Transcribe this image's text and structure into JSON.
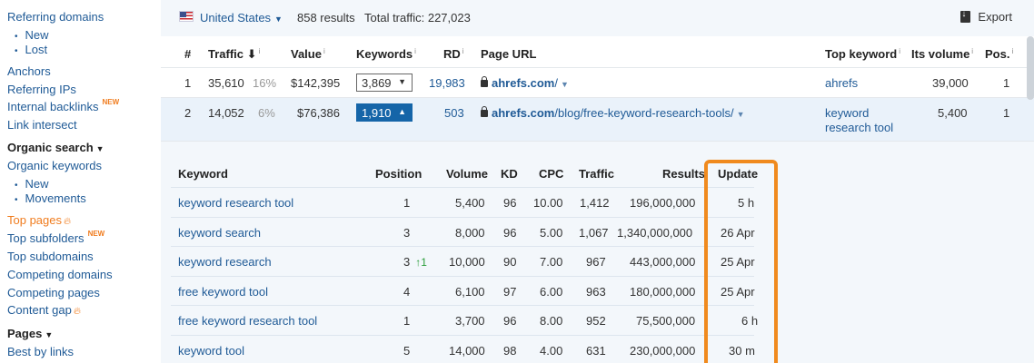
{
  "sidebar": {
    "referring_domains": "Referring domains",
    "rd_new": "New",
    "rd_lost": "Lost",
    "anchors": "Anchors",
    "referring_ips": "Referring IPs",
    "internal_backlinks": "Internal backlinks",
    "new_badge": "NEW",
    "link_intersect": "Link intersect",
    "organic_search": "Organic search",
    "organic_keywords": "Organic keywords",
    "ok_new": "New",
    "ok_movements": "Movements",
    "top_pages": "Top pages",
    "top_subfolders": "Top subfolders",
    "top_subdomains": "Top subdomains",
    "competing_domains": "Competing domains",
    "competing_pages": "Competing pages",
    "content_gap": "Content gap",
    "pages": "Pages",
    "best_by_links": "Best by links"
  },
  "topbar": {
    "country": "United States",
    "results": "858 results",
    "total_traffic": "Total traffic: 227,023",
    "export": "Export"
  },
  "pages_table": {
    "headers": {
      "num": "#",
      "traffic": "Traffic",
      "value": "Value",
      "keywords": "Keywords",
      "rd": "RD",
      "page_url": "Page URL",
      "top_keyword": "Top keyword",
      "its_volume": "Its volume",
      "pos": "Pos."
    },
    "rows": [
      {
        "num": "1",
        "traffic": "35,610",
        "share": "16%",
        "value": "$142,395",
        "keywords": "3,869",
        "rd": "19,983",
        "domain": "ahrefs.com",
        "path": "/",
        "top_keyword": "ahrefs",
        "top_keyword_2": "",
        "volume": "39,000",
        "pos": "1"
      },
      {
        "num": "2",
        "traffic": "14,052",
        "share": "6%",
        "value": "$76,386",
        "keywords": "1,910",
        "rd": "503",
        "domain": "ahrefs.com",
        "path": "/blog/free-keyword-research-tools/",
        "top_keyword": "keyword",
        "top_keyword_2": "research tool",
        "volume": "5,400",
        "pos": "1"
      }
    ]
  },
  "keyword_table": {
    "headers": {
      "keyword": "Keyword",
      "position": "Position",
      "volume": "Volume",
      "kd": "KD",
      "cpc": "CPC",
      "traffic": "Traffic",
      "results": "Results",
      "update": "Update"
    },
    "rows": [
      {
        "keyword": "keyword research tool",
        "position": "1",
        "change": "",
        "volume": "5,400",
        "kd": "96",
        "cpc": "10.00",
        "traffic": "1,412",
        "results": "196,000,000",
        "update": "5 h"
      },
      {
        "keyword": "keyword search",
        "position": "3",
        "change": "",
        "volume": "8,000",
        "kd": "96",
        "cpc": "5.00",
        "traffic": "1,067",
        "results": "1,340,000,000",
        "update": "26 Apr"
      },
      {
        "keyword": "keyword research",
        "position": "3",
        "change": "1",
        "volume": "10,000",
        "kd": "90",
        "cpc": "7.00",
        "traffic": "967",
        "results": "443,000,000",
        "update": "25 Apr"
      },
      {
        "keyword": "free keyword tool",
        "position": "4",
        "change": "",
        "volume": "6,100",
        "kd": "97",
        "cpc": "6.00",
        "traffic": "963",
        "results": "180,000,000",
        "update": "25 Apr"
      },
      {
        "keyword": "free keyword research tool",
        "position": "1",
        "change": "",
        "volume": "3,700",
        "kd": "96",
        "cpc": "8.00",
        "traffic": "952",
        "results": "75,500,000",
        "update": "6 h"
      },
      {
        "keyword": "keyword tool",
        "position": "5",
        "change": "",
        "volume": "14,000",
        "kd": "98",
        "cpc": "4.00",
        "traffic": "631",
        "results": "230,000,000",
        "update": "30 m"
      }
    ]
  },
  "colors": {
    "accent_orange": "#f08a1e",
    "link_blue": "#1f5a96",
    "active_button": "#1565a8"
  }
}
